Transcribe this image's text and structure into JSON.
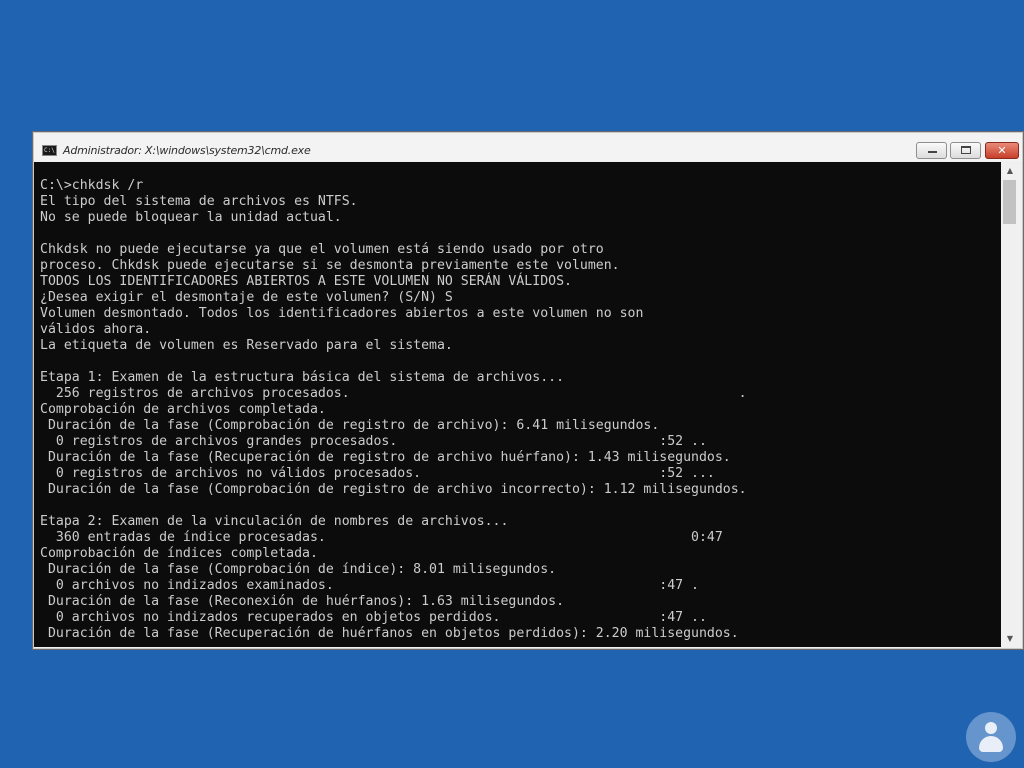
{
  "window": {
    "title": "Administrador: X:\\windows\\system32\\cmd.exe",
    "icon": "cmd-icon",
    "icon_text": "C:\\",
    "controls": {
      "minimize": "minimize-icon",
      "maximize": "maximize-icon",
      "close_symbol": "✕"
    }
  },
  "console": {
    "lines": [
      "C:\\>chkdsk /r",
      "El tipo del sistema de archivos es NTFS.",
      "No se puede bloquear la unidad actual.",
      "",
      "Chkdsk no puede ejecutarse ya que el volumen está siendo usado por otro",
      "proceso. Chkdsk puede ejecutarse si se desmonta previamente este volumen.",
      "TODOS LOS IDENTIFICADORES ABIERTOS A ESTE VOLUMEN NO SERÁN VÁLIDOS.",
      "¿Desea exigir el desmontaje de este volumen? (S/N) S",
      "Volumen desmontado. Todos los identificadores abiertos a este volumen no son",
      "válidos ahora.",
      "La etiqueta de volumen es Reservado para el sistema.",
      "",
      "Etapa 1: Examen de la estructura básica del sistema de archivos...",
      "  256 registros de archivos procesados.                                                 .",
      "Comprobación de archivos completada.",
      " Duración de la fase (Comprobación de registro de archivo): 6.41 milisegundos.",
      "  0 registros de archivos grandes procesados.                                 :52 ..",
      " Duración de la fase (Recuperación de registro de archivo huérfano): 1.43 milisegundos.",
      "  0 registros de archivos no válidos procesados.                              :52 ...",
      " Duración de la fase (Comprobación de registro de archivo incorrecto): 1.12 milisegundos.",
      "",
      "Etapa 2: Examen de la vinculación de nombres de archivos...",
      "  360 entradas de índice procesadas.                                              0:47",
      "Comprobación de índices completada.",
      " Duración de la fase (Comprobación de índice): 8.01 milisegundos.",
      "  0 archivos no indizados examinados.                                         :47 .",
      " Duración de la fase (Reconexión de huérfanos): 1.63 milisegundos.",
      "  0 archivos no indizados recuperados en objetos perdidos.                    :47 ..",
      " Duración de la fase (Recuperación de huérfanos en objetos perdidos): 2.20 milisegundos."
    ]
  },
  "scrollbar": {
    "up_symbol": "▲",
    "down_symbol": "▼"
  },
  "colors": {
    "desktop": "#1f63b1",
    "console_bg": "#0c0c0c",
    "console_text": "#cccccc"
  }
}
